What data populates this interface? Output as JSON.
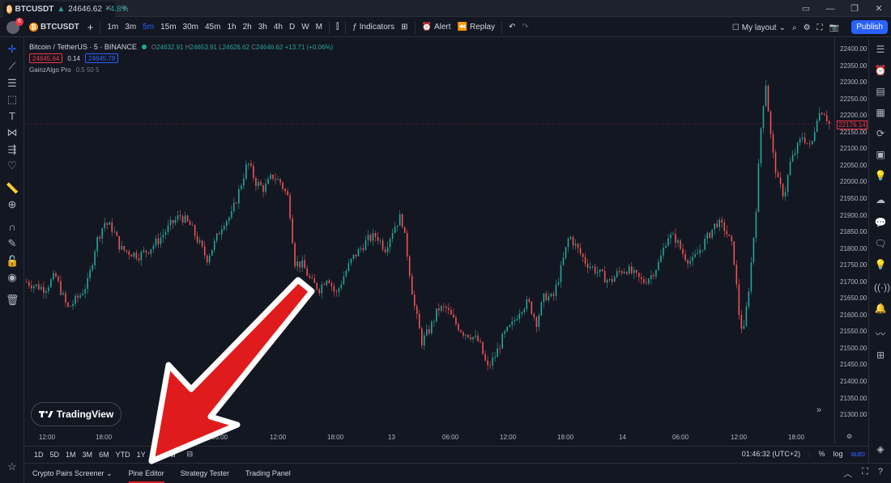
{
  "browser": {
    "tab_symbol": "BTCUSDT",
    "tab_price": "24646.62",
    "tab_change": "+4.8%",
    "tab_coin": "₿",
    "new_tab": "+"
  },
  "toolbar": {
    "avatar_badge": "6",
    "symbol": "BTCUSDT",
    "add_symbol": "+",
    "intervals": [
      "1m",
      "3m",
      "5m",
      "15m",
      "30m",
      "45m",
      "1h",
      "2h",
      "3h",
      "4h",
      "D",
      "W",
      "M"
    ],
    "active_interval": "5m",
    "indicators": "Indicators",
    "alert": "Alert",
    "replay": "Replay",
    "layout": "My layout",
    "publish": "Publish"
  },
  "legend": {
    "title": "Bitcoin / TetherUS · 5 · BINANCE",
    "o_label": "O",
    "o": "24632.91",
    "h_label": "H",
    "h": "24653.91",
    "l_label": "L",
    "l": "24626.62",
    "c_label": "C",
    "c": "24646.62",
    "change": "+13.71 (+0.06%)",
    "sell": "24645.64",
    "spread": "0.14",
    "buy": "24645.78",
    "indicator_name": "GainzAlgo Pro",
    "indicator_params": "0.5 50 5"
  },
  "price_axis": {
    "labels": [
      "22400.00",
      "22350.00",
      "22300.00",
      "22250.00",
      "22200.00",
      "22150.00",
      "22100.00",
      "22050.00",
      "22000.00",
      "21950.00",
      "21900.00",
      "21850.00",
      "21800.00",
      "21750.00",
      "21700.00",
      "21650.00",
      "21600.00",
      "21550.00",
      "21500.00",
      "21450.00",
      "21400.00",
      "21350.00",
      "21300.00"
    ],
    "current": "22176.14"
  },
  "time_axis": {
    "labels": [
      "12:00",
      "18:00",
      "06:00",
      "12:00",
      "18:00",
      "13",
      "06:00",
      "12:00",
      "18:00",
      "14",
      "06:00",
      "12:00",
      "18:00"
    ]
  },
  "range_bar": {
    "ranges": [
      "1D",
      "5D",
      "1M",
      "3M",
      "6M",
      "YTD",
      "1Y",
      "5Y",
      "All"
    ],
    "clock": "01:46:32 (UTC+2)",
    "percent": "%",
    "log": "log",
    "auto": "auto"
  },
  "bottom_tabs": {
    "tabs": [
      "Crypto Pairs Screener",
      "Pine Editor",
      "Strategy Tester",
      "Trading Panel"
    ],
    "active": "Pine Editor"
  },
  "logo": {
    "text": "TradingView"
  },
  "colors": {
    "up": "#26a69a",
    "down": "#ef5350",
    "accent": "#2962ff",
    "annotation": "#e01b1b"
  },
  "chart_data": {
    "type": "candlestick",
    "ylim": [
      21300,
      22400
    ],
    "close_path": [
      [
        0,
        21700
      ],
      [
        8,
        21690
      ],
      [
        18,
        21680
      ],
      [
        28,
        21720
      ],
      [
        40,
        21620
      ],
      [
        52,
        21660
      ],
      [
        60,
        21700
      ],
      [
        68,
        21820
      ],
      [
        76,
        21880
      ],
      [
        84,
        21860
      ],
      [
        92,
        21800
      ],
      [
        100,
        21790
      ],
      [
        110,
        21780
      ],
      [
        120,
        21800
      ],
      [
        130,
        21830
      ],
      [
        140,
        21870
      ],
      [
        150,
        21900
      ],
      [
        160,
        21870
      ],
      [
        168,
        21820
      ],
      [
        176,
        21770
      ],
      [
        184,
        21820
      ],
      [
        192,
        21880
      ],
      [
        200,
        21900
      ],
      [
        208,
        21980
      ],
      [
        216,
        22060
      ],
      [
        224,
        22000
      ],
      [
        232,
        21980
      ],
      [
        240,
        22020
      ],
      [
        248,
        22000
      ],
      [
        256,
        21950
      ],
      [
        262,
        21760
      ],
      [
        270,
        21750
      ],
      [
        278,
        21700
      ],
      [
        286,
        21680
      ],
      [
        294,
        21720
      ],
      [
        302,
        21660
      ],
      [
        310,
        21720
      ],
      [
        318,
        21770
      ],
      [
        326,
        21800
      ],
      [
        334,
        21830
      ],
      [
        342,
        21840
      ],
      [
        350,
        21800
      ],
      [
        358,
        21860
      ],
      [
        366,
        21900
      ],
      [
        372,
        21780
      ],
      [
        378,
        21640
      ],
      [
        386,
        21520
      ],
      [
        394,
        21560
      ],
      [
        402,
        21620
      ],
      [
        410,
        21620
      ],
      [
        418,
        21580
      ],
      [
        426,
        21550
      ],
      [
        434,
        21540
      ],
      [
        442,
        21520
      ],
      [
        450,
        21440
      ],
      [
        458,
        21480
      ],
      [
        466,
        21540
      ],
      [
        474,
        21570
      ],
      [
        482,
        21620
      ],
      [
        490,
        21640
      ],
      [
        498,
        21580
      ],
      [
        506,
        21660
      ],
      [
        514,
        21650
      ],
      [
        522,
        21740
      ],
      [
        530,
        21840
      ],
      [
        538,
        21800
      ],
      [
        546,
        21760
      ],
      [
        554,
        21740
      ],
      [
        562,
        21720
      ],
      [
        570,
        21700
      ],
      [
        578,
        21730
      ],
      [
        586,
        21740
      ],
      [
        594,
        21720
      ],
      [
        602,
        21700
      ],
      [
        610,
        21720
      ],
      [
        618,
        21760
      ],
      [
        626,
        21840
      ],
      [
        634,
        21830
      ],
      [
        642,
        21780
      ],
      [
        650,
        21760
      ],
      [
        658,
        21800
      ],
      [
        666,
        21840
      ],
      [
        674,
        21880
      ],
      [
        682,
        21860
      ],
      [
        690,
        21800
      ],
      [
        696,
        21600
      ],
      [
        700,
        21540
      ],
      [
        706,
        21700
      ],
      [
        712,
        21900
      ],
      [
        718,
        22200
      ],
      [
        722,
        22300
      ],
      [
        728,
        22100
      ],
      [
        734,
        22000
      ],
      [
        740,
        21960
      ],
      [
        746,
        22060
      ],
      [
        752,
        22100
      ],
      [
        758,
        22140
      ],
      [
        766,
        22100
      ],
      [
        772,
        22200
      ],
      [
        778,
        22220
      ],
      [
        784,
        22176
      ]
    ],
    "x_max": 784
  }
}
